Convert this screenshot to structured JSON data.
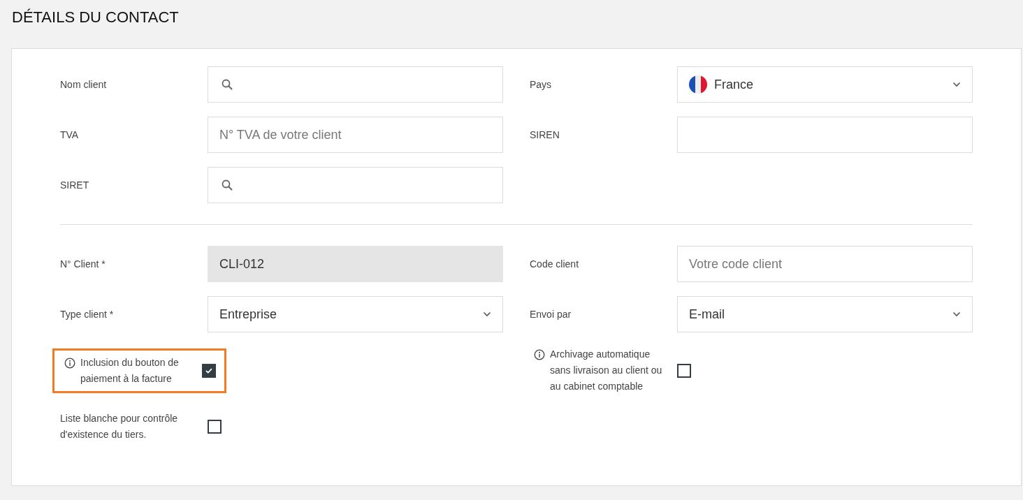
{
  "title": "DÉTAILS DU CONTACT",
  "sections": [
    {
      "rows": [
        {
          "left": {
            "kind": "search",
            "label": "Nom client"
          },
          "right": {
            "kind": "country",
            "label": "Pays",
            "value": "France"
          }
        },
        {
          "left": {
            "kind": "text",
            "label": "TVA",
            "placeholder": "N° TVA de votre client"
          },
          "right": {
            "kind": "text",
            "label": "SIREN"
          }
        },
        {
          "left": {
            "kind": "search",
            "label": "SIRET"
          }
        }
      ]
    },
    {
      "rows": [
        {
          "left": {
            "kind": "readonly",
            "label": "N° Client *",
            "value": "CLI-012"
          },
          "right": {
            "kind": "text",
            "label": "Code client",
            "placeholder": "Votre code client"
          }
        },
        {
          "left": {
            "kind": "select",
            "label": "Type client *",
            "value": "Entreprise"
          },
          "right": {
            "kind": "select",
            "label": "Envoi par",
            "value": "E-mail"
          }
        },
        {
          "left": {
            "kind": "checkbox",
            "label": "Inclusion du bouton de paiement à la facture",
            "info": true,
            "checked": true,
            "highlighted": true
          },
          "right": {
            "kind": "checkbox",
            "label": "Archivage automatique sans livraison au client ou au cabinet comptable",
            "info": true,
            "checked": false,
            "highlighted": false
          }
        },
        {
          "left": {
            "kind": "checkbox",
            "label": "Liste blanche pour contrôle d'existence du tiers.",
            "info": false,
            "checked": false,
            "highlighted": false
          }
        }
      ]
    }
  ]
}
